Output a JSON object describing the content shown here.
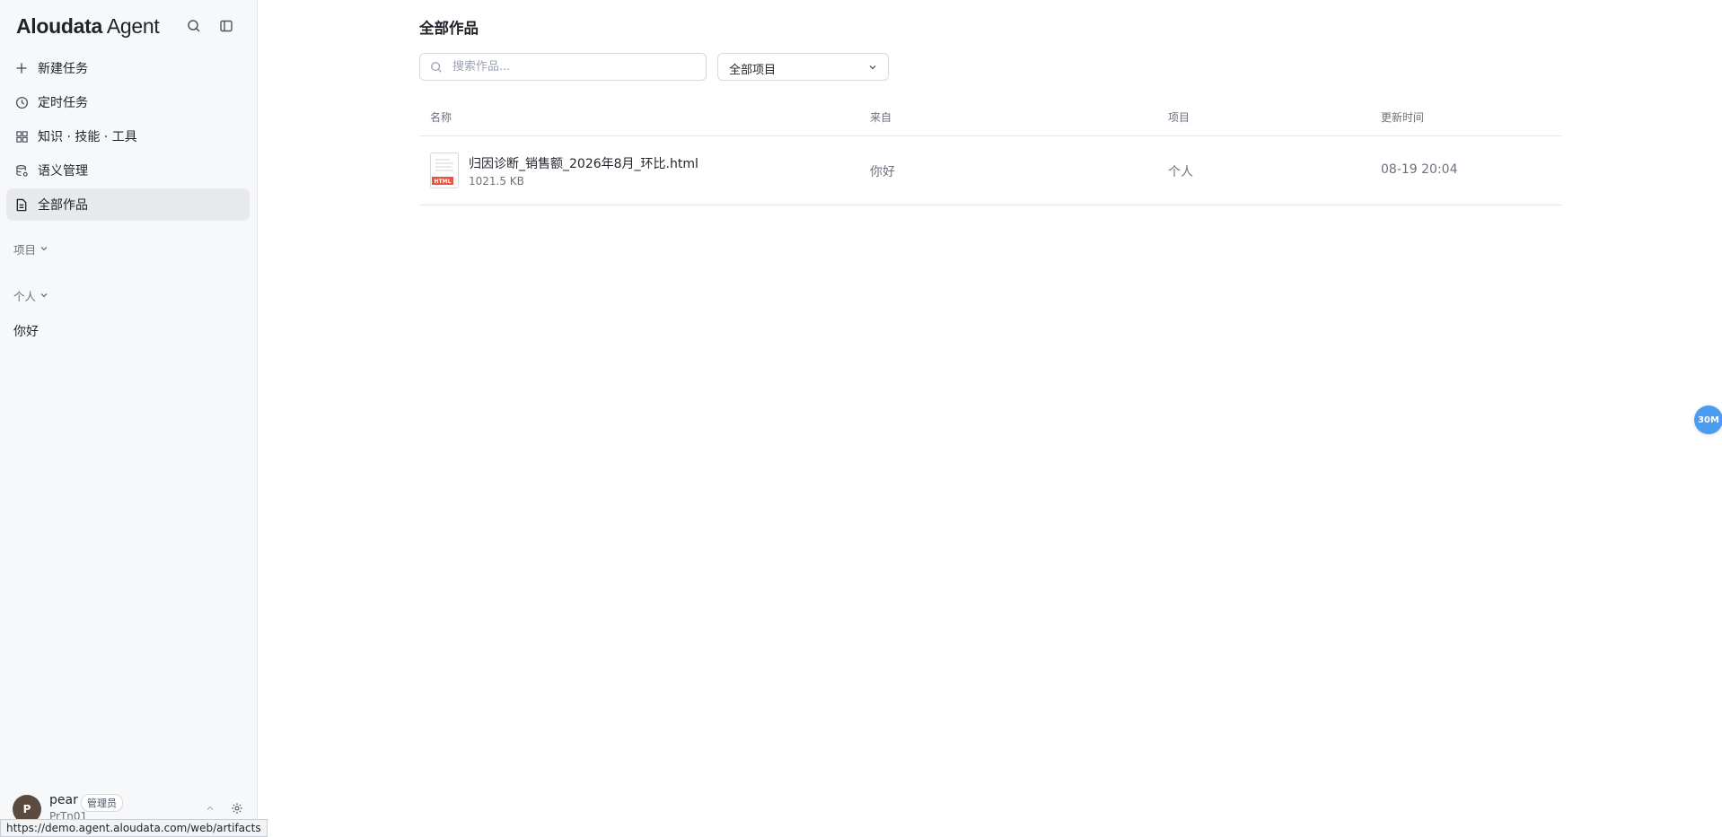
{
  "brand": {
    "name_bold": "Aloudata",
    "name_light": " Agent"
  },
  "sidebar": {
    "nav": [
      {
        "label": "新建任务",
        "icon": "plus-icon"
      },
      {
        "label": "定时任务",
        "icon": "clock-icon"
      },
      {
        "label": "知识 · 技能 · 工具",
        "icon": "grid-icon"
      },
      {
        "label": "语义管理",
        "icon": "database-gear-icon"
      },
      {
        "label": "全部作品",
        "icon": "document-icon",
        "active": true
      }
    ],
    "sections": {
      "projects_label": "项目",
      "personal_label": "个人",
      "personal_item": "你好"
    },
    "user": {
      "avatar_letter": "P",
      "name": "pear",
      "role": "管理员",
      "sub": "PrTn01"
    },
    "status_url": "https://demo.agent.aloudata.com/web/artifacts"
  },
  "main": {
    "title": "全部作品",
    "search": {
      "placeholder": "搜索作品...",
      "value": ""
    },
    "filter": {
      "selected": "全部项目"
    },
    "table": {
      "columns": [
        "名称",
        "来自",
        "项目",
        "更新时间"
      ],
      "rows": [
        {
          "name": "归因诊断_销售额_2026年8月_环比.html",
          "size": "1021.5 KB",
          "file_badge": "HTML",
          "from": "你好",
          "project": "个人",
          "updated": "08-19 20:04"
        }
      ]
    }
  },
  "float_button": {
    "label": "30M"
  },
  "colors": {
    "accent": "#4c9cf0",
    "html_badge": "#e8553e",
    "sidebar_bg": "#f7f8fa",
    "active_item_bg": "#e8e9ec"
  }
}
